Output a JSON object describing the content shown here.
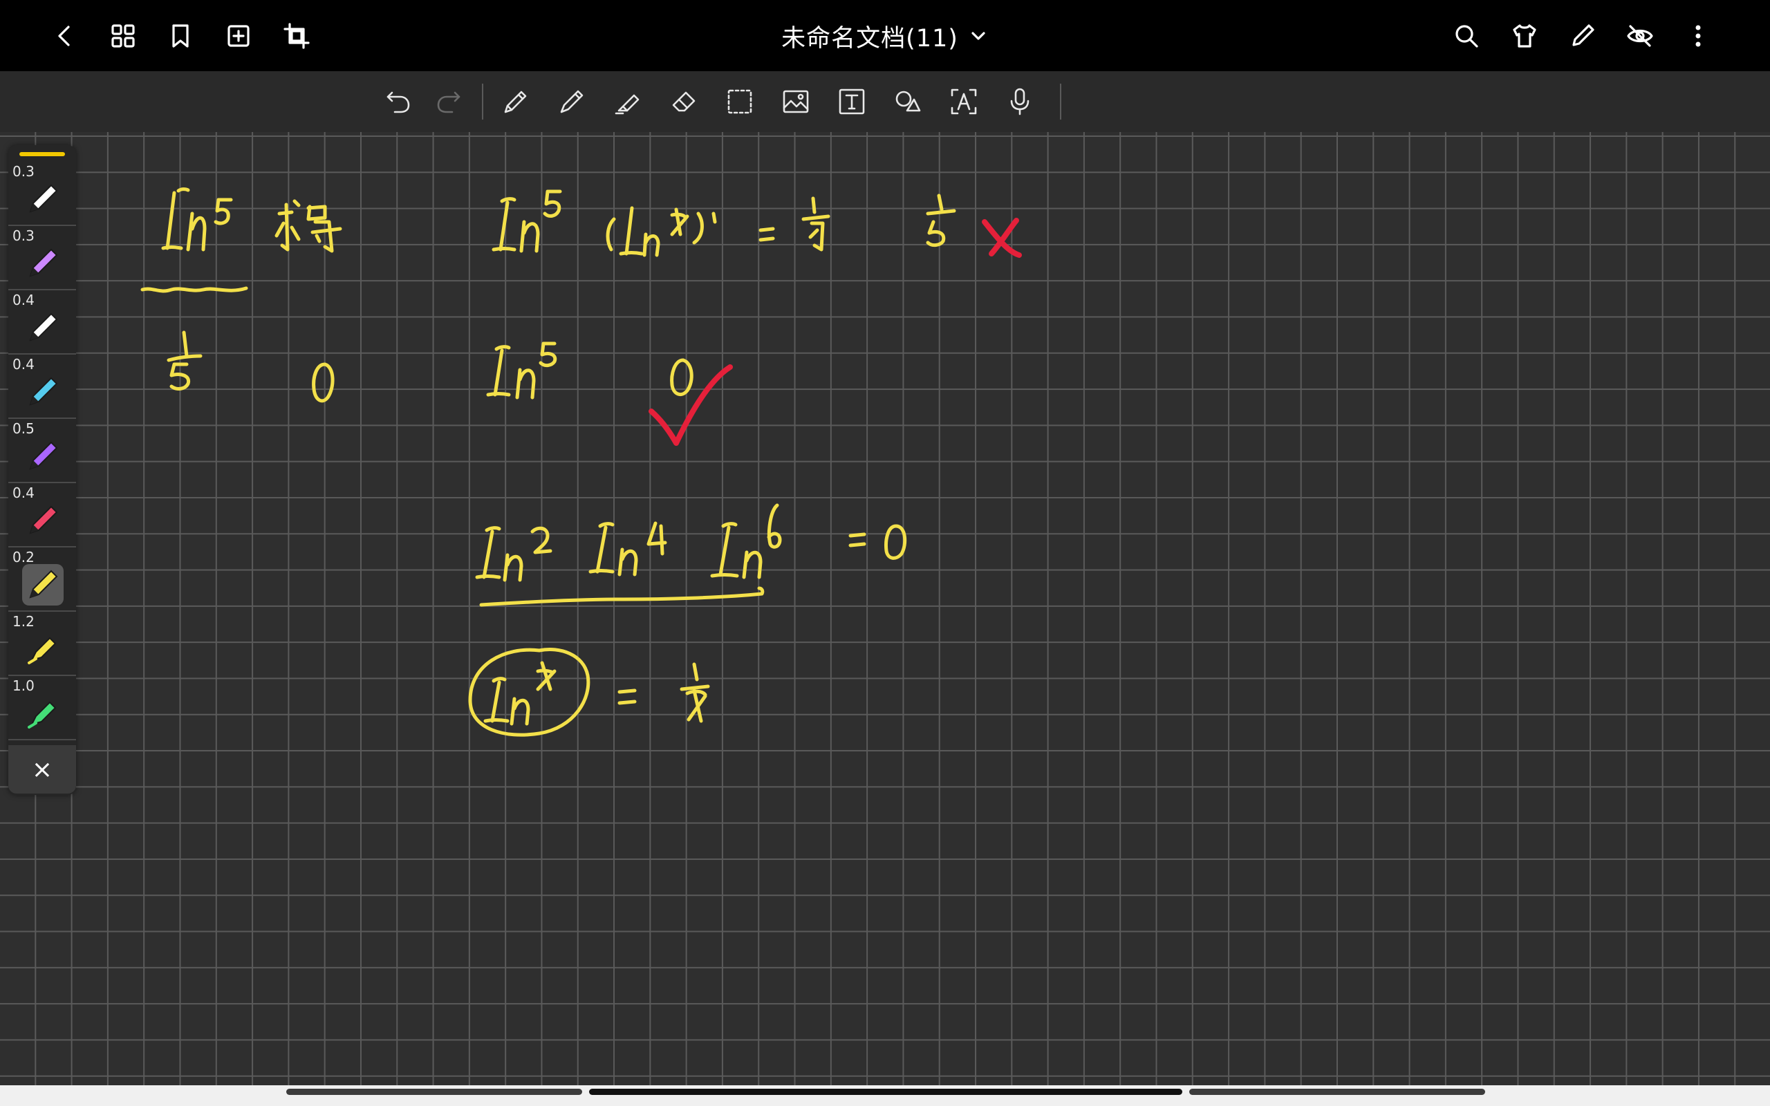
{
  "header": {
    "doc_title": "未命名文档(11)",
    "buttons": [
      "back-icon",
      "grid-view-icon",
      "bookmark-icon",
      "add-page-icon",
      "crop-icon",
      "search-icon",
      "shirt-icon",
      "pen-mode-icon",
      "eye-off-icon",
      "more-icon"
    ]
  },
  "toolbar": {
    "tools": [
      "undo-icon",
      "redo-icon",
      "fountain-pen-icon",
      "pen-icon",
      "highlighter-icon",
      "eraser-icon",
      "lasso-select-icon",
      "image-icon",
      "text-box-icon",
      "shape-icon",
      "text-recognition-icon",
      "microphone-icon"
    ]
  },
  "palette": {
    "pens": [
      {
        "size": "0.3",
        "color": "#ffffff"
      },
      {
        "size": "0.3",
        "color": "#cc88ff"
      },
      {
        "size": "0.4",
        "color": "#ffffff"
      },
      {
        "size": "0.4",
        "color": "#55ccee"
      },
      {
        "size": "0.5",
        "color": "#aa66ff"
      },
      {
        "size": "0.4",
        "color": "#ee4466"
      },
      {
        "size": "0.2",
        "color": "#f5e34a"
      },
      {
        "size": "1.2",
        "color": "#f5e34a"
      },
      {
        "size": "1.0",
        "color": "#44dd77"
      }
    ],
    "close_label": "×",
    "accent_color": "#f2c800"
  },
  "colors": {
    "ink_yellow": "#f3e04a",
    "ink_red": "#e5203a"
  }
}
